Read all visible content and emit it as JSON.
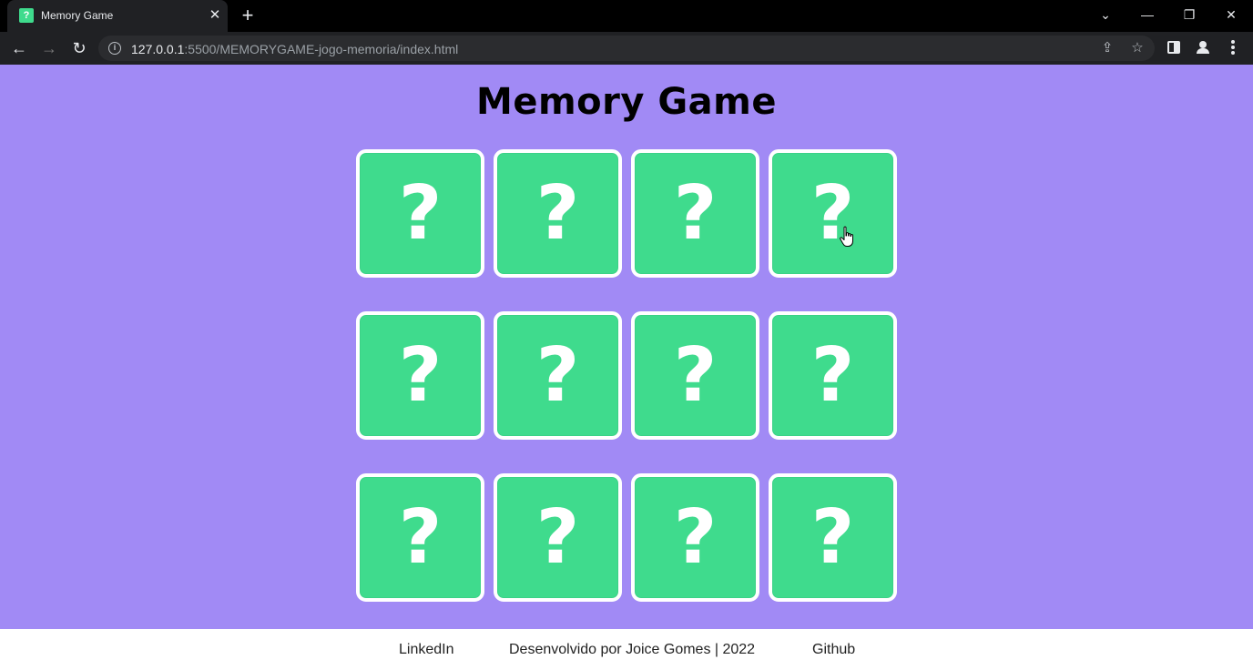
{
  "browser": {
    "tab": {
      "title": "Memory Game",
      "favicon_glyph": "?",
      "close_glyph": "✕"
    },
    "new_tab_glyph": "+",
    "window_controls": {
      "tab_search_glyph": "⌄",
      "minimize_glyph": "—",
      "restore_glyph": "❐",
      "close_glyph": "✕"
    },
    "nav": {
      "back_glyph": "←",
      "forward_glyph": "→",
      "reload_glyph": "↻"
    },
    "address": {
      "host": "127.0.0.1",
      "rest": ":5500/MEMORYGAME-jogo-memoria/index.html",
      "info_glyph": "i"
    },
    "icons": {
      "share": "share-icon",
      "bookmark": "star-icon",
      "sidepanel": "side-panel-icon",
      "profile": "profile-icon",
      "menu": "kebab-menu-icon"
    },
    "share_glyph": "⇪",
    "star_glyph": "☆"
  },
  "page": {
    "title": "Memory Game",
    "background_color": "#a18af5",
    "card_color": "#3fdb8d",
    "cards": [
      {
        "label": "?"
      },
      {
        "label": "?"
      },
      {
        "label": "?"
      },
      {
        "label": "?"
      },
      {
        "label": "?"
      },
      {
        "label": "?"
      },
      {
        "label": "?"
      },
      {
        "label": "?"
      },
      {
        "label": "?"
      },
      {
        "label": "?"
      },
      {
        "label": "?"
      },
      {
        "label": "?"
      }
    ]
  },
  "footer": {
    "linkedin": "LinkedIn",
    "credit": "Desenvolvido por Joice Gomes | 2022",
    "github": "Github"
  }
}
